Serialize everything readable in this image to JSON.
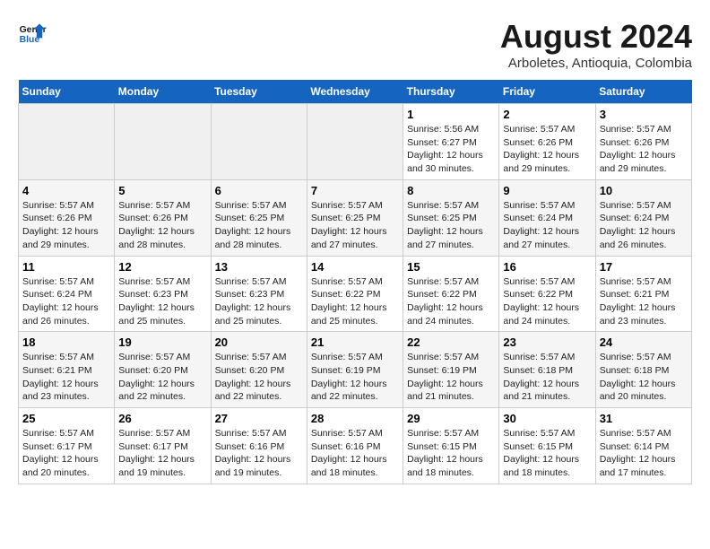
{
  "header": {
    "logo_line1": "General",
    "logo_line2": "Blue",
    "month_year": "August 2024",
    "location": "Arboletes, Antioquia, Colombia"
  },
  "weekdays": [
    "Sunday",
    "Monday",
    "Tuesday",
    "Wednesday",
    "Thursday",
    "Friday",
    "Saturday"
  ],
  "weeks": [
    [
      {
        "day": "",
        "sunrise": "",
        "sunset": "",
        "daylight": ""
      },
      {
        "day": "",
        "sunrise": "",
        "sunset": "",
        "daylight": ""
      },
      {
        "day": "",
        "sunrise": "",
        "sunset": "",
        "daylight": ""
      },
      {
        "day": "",
        "sunrise": "",
        "sunset": "",
        "daylight": ""
      },
      {
        "day": "1",
        "sunrise": "5:56 AM",
        "sunset": "6:27 PM",
        "daylight": "12 hours and 30 minutes."
      },
      {
        "day": "2",
        "sunrise": "5:57 AM",
        "sunset": "6:26 PM",
        "daylight": "12 hours and 29 minutes."
      },
      {
        "day": "3",
        "sunrise": "5:57 AM",
        "sunset": "6:26 PM",
        "daylight": "12 hours and 29 minutes."
      }
    ],
    [
      {
        "day": "4",
        "sunrise": "5:57 AM",
        "sunset": "6:26 PM",
        "daylight": "12 hours and 29 minutes."
      },
      {
        "day": "5",
        "sunrise": "5:57 AM",
        "sunset": "6:26 PM",
        "daylight": "12 hours and 28 minutes."
      },
      {
        "day": "6",
        "sunrise": "5:57 AM",
        "sunset": "6:25 PM",
        "daylight": "12 hours and 28 minutes."
      },
      {
        "day": "7",
        "sunrise": "5:57 AM",
        "sunset": "6:25 PM",
        "daylight": "12 hours and 27 minutes."
      },
      {
        "day": "8",
        "sunrise": "5:57 AM",
        "sunset": "6:25 PM",
        "daylight": "12 hours and 27 minutes."
      },
      {
        "day": "9",
        "sunrise": "5:57 AM",
        "sunset": "6:24 PM",
        "daylight": "12 hours and 27 minutes."
      },
      {
        "day": "10",
        "sunrise": "5:57 AM",
        "sunset": "6:24 PM",
        "daylight": "12 hours and 26 minutes."
      }
    ],
    [
      {
        "day": "11",
        "sunrise": "5:57 AM",
        "sunset": "6:24 PM",
        "daylight": "12 hours and 26 minutes."
      },
      {
        "day": "12",
        "sunrise": "5:57 AM",
        "sunset": "6:23 PM",
        "daylight": "12 hours and 25 minutes."
      },
      {
        "day": "13",
        "sunrise": "5:57 AM",
        "sunset": "6:23 PM",
        "daylight": "12 hours and 25 minutes."
      },
      {
        "day": "14",
        "sunrise": "5:57 AM",
        "sunset": "6:22 PM",
        "daylight": "12 hours and 25 minutes."
      },
      {
        "day": "15",
        "sunrise": "5:57 AM",
        "sunset": "6:22 PM",
        "daylight": "12 hours and 24 minutes."
      },
      {
        "day": "16",
        "sunrise": "5:57 AM",
        "sunset": "6:22 PM",
        "daylight": "12 hours and 24 minutes."
      },
      {
        "day": "17",
        "sunrise": "5:57 AM",
        "sunset": "6:21 PM",
        "daylight": "12 hours and 23 minutes."
      }
    ],
    [
      {
        "day": "18",
        "sunrise": "5:57 AM",
        "sunset": "6:21 PM",
        "daylight": "12 hours and 23 minutes."
      },
      {
        "day": "19",
        "sunrise": "5:57 AM",
        "sunset": "6:20 PM",
        "daylight": "12 hours and 22 minutes."
      },
      {
        "day": "20",
        "sunrise": "5:57 AM",
        "sunset": "6:20 PM",
        "daylight": "12 hours and 22 minutes."
      },
      {
        "day": "21",
        "sunrise": "5:57 AM",
        "sunset": "6:19 PM",
        "daylight": "12 hours and 22 minutes."
      },
      {
        "day": "22",
        "sunrise": "5:57 AM",
        "sunset": "6:19 PM",
        "daylight": "12 hours and 21 minutes."
      },
      {
        "day": "23",
        "sunrise": "5:57 AM",
        "sunset": "6:18 PM",
        "daylight": "12 hours and 21 minutes."
      },
      {
        "day": "24",
        "sunrise": "5:57 AM",
        "sunset": "6:18 PM",
        "daylight": "12 hours and 20 minutes."
      }
    ],
    [
      {
        "day": "25",
        "sunrise": "5:57 AM",
        "sunset": "6:17 PM",
        "daylight": "12 hours and 20 minutes."
      },
      {
        "day": "26",
        "sunrise": "5:57 AM",
        "sunset": "6:17 PM",
        "daylight": "12 hours and 19 minutes."
      },
      {
        "day": "27",
        "sunrise": "5:57 AM",
        "sunset": "6:16 PM",
        "daylight": "12 hours and 19 minutes."
      },
      {
        "day": "28",
        "sunrise": "5:57 AM",
        "sunset": "6:16 PM",
        "daylight": "12 hours and 18 minutes."
      },
      {
        "day": "29",
        "sunrise": "5:57 AM",
        "sunset": "6:15 PM",
        "daylight": "12 hours and 18 minutes."
      },
      {
        "day": "30",
        "sunrise": "5:57 AM",
        "sunset": "6:15 PM",
        "daylight": "12 hours and 18 minutes."
      },
      {
        "day": "31",
        "sunrise": "5:57 AM",
        "sunset": "6:14 PM",
        "daylight": "12 hours and 17 minutes."
      }
    ]
  ]
}
